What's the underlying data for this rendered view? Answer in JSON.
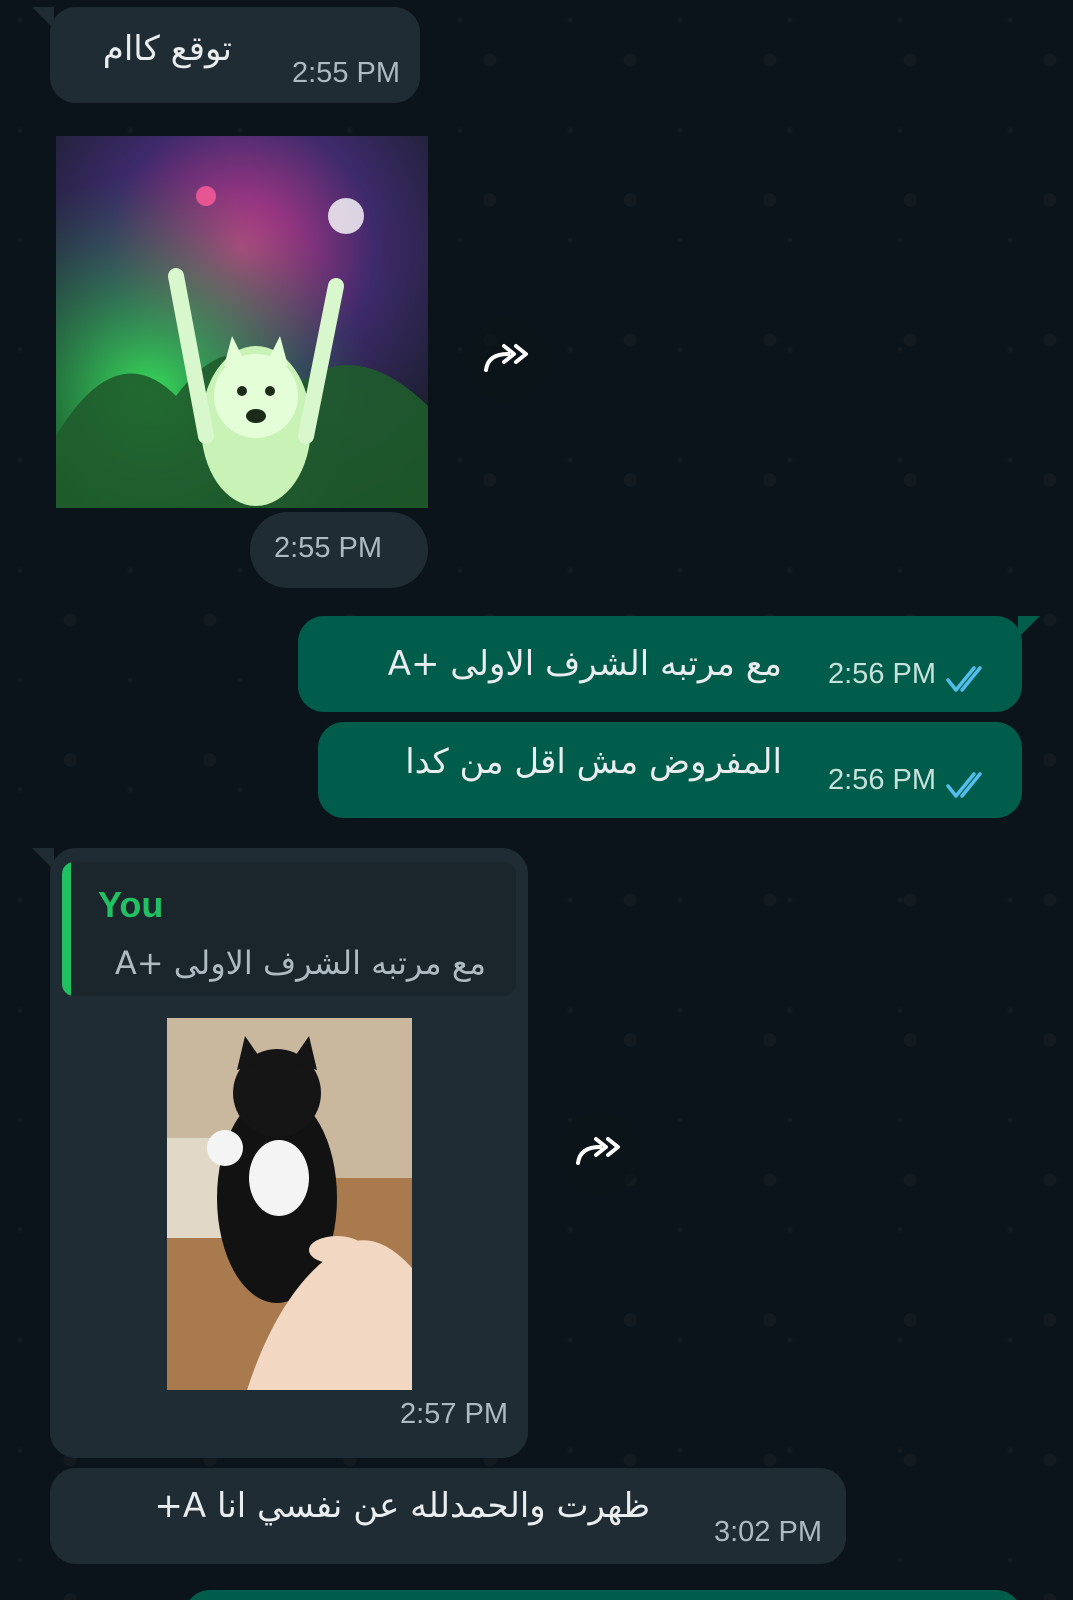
{
  "messages": {
    "m1": {
      "text": "توقع كاام",
      "time": "2:55 PM"
    },
    "m2": {
      "time": "2:55 PM",
      "image": "dancing-cat-party-gif"
    },
    "m3": {
      "text": "مع مرتبه الشرف الاولى +A",
      "time": "2:56 PM",
      "status": "read"
    },
    "m4": {
      "text": "المفروض مش اقل من كدا",
      "time": "2:56 PM",
      "status": "read"
    },
    "m5": {
      "quote_author": "You",
      "quote_text": "مع مرتبه الشرف الاولى +A",
      "time": "2:57 PM",
      "image": "cat-high-five-gif"
    },
    "m6": {
      "text": "ظهرت والحمدلله عن نفسي انا A+",
      "time": "3:02 PM"
    }
  },
  "icons": {
    "forward": "forward-icon",
    "read_receipt": "double-check-icon"
  },
  "colors": {
    "background": "#0b141a",
    "incoming_bubble": "#202c33",
    "outgoing_bubble": "#005c4b",
    "read_tick": "#53bdeb",
    "quote_accent": "#21c063"
  }
}
